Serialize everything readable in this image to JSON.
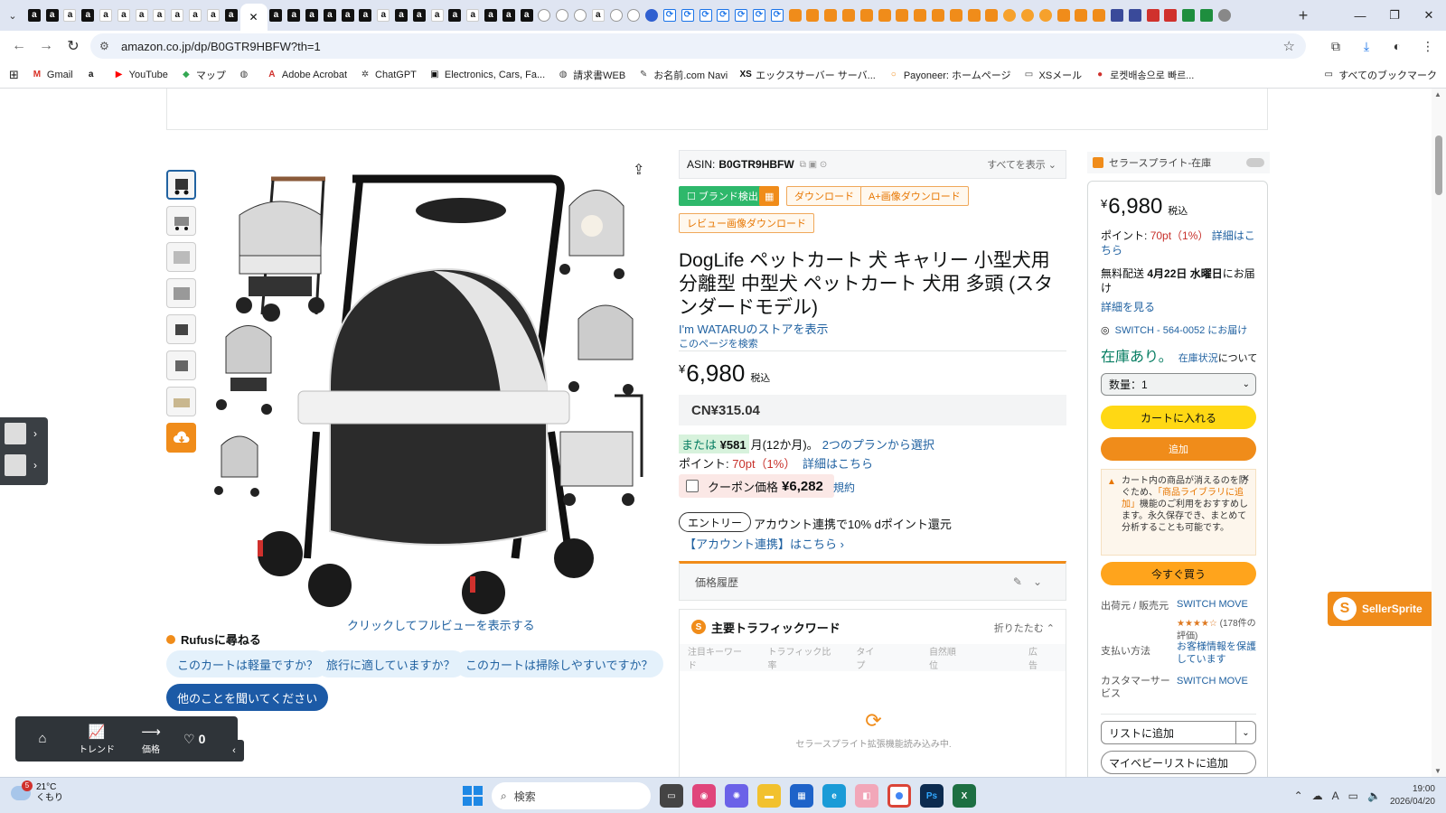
{
  "browser": {
    "url": "amazon.co.jp/dp/B0GTR9HBFW?th=1",
    "tab_icon_kinds": [
      "amz-black",
      "amz-black",
      "amz-white",
      "amz-black",
      "amz-white",
      "amz-white",
      "amz-white",
      "amz-white",
      "amz-white",
      "amz-white",
      "amz-white",
      "amz-black",
      "active",
      "amz-black",
      "amz-black",
      "amz-black",
      "amz-black",
      "amz-black",
      "amz-black",
      "amz-white",
      "amz-black",
      "amz-black",
      "amz-white",
      "amz-black",
      "amz-white",
      "amz-black",
      "amz-black",
      "amz-black",
      "circle",
      "circle",
      "circle",
      "amz-white",
      "circle",
      "circle",
      "blue",
      "chat",
      "chat",
      "chat",
      "chat",
      "chat",
      "chat",
      "chat",
      "orange",
      "orange",
      "orange",
      "orange",
      "orange",
      "orange",
      "orange",
      "orange",
      "orange",
      "orange",
      "orange",
      "orange",
      "oc",
      "oc",
      "oc",
      "orange",
      "orange",
      "orange",
      "navy",
      "navy",
      "red",
      "red",
      "green",
      "green",
      "gray"
    ],
    "bookmarks": [
      {
        "label": "Gmail",
        "icon": "gmail-icon",
        "color": "#d93025",
        "glyph": "M"
      },
      {
        "label": "",
        "icon": "amazon-icon",
        "color": "#111111",
        "glyph": "a"
      },
      {
        "label": "YouTube",
        "icon": "youtube-icon",
        "color": "#ff0000",
        "glyph": "▶"
      },
      {
        "label": "マップ",
        "icon": "maps-icon",
        "color": "#34a853",
        "glyph": "◆"
      },
      {
        "label": "",
        "icon": "globe-icon",
        "color": "#444444",
        "glyph": "◍"
      },
      {
        "label": "Adobe Acrobat",
        "icon": "acrobat-icon",
        "color": "#d0312d",
        "glyph": "A"
      },
      {
        "label": "ChatGPT",
        "icon": "chatgpt-icon",
        "color": "#444444",
        "glyph": "✲"
      },
      {
        "label": "Electronics, Cars, Fa...",
        "icon": "shop-icon",
        "color": "#111111",
        "glyph": "▣"
      },
      {
        "label": "請求書WEB",
        "icon": "globe-icon",
        "color": "#444444",
        "glyph": "◍"
      },
      {
        "label": "お名前.com Navi",
        "icon": "onamae-icon",
        "color": "#444444",
        "glyph": "✎"
      },
      {
        "label": "エックスサーバー サーバ...",
        "icon": "xserver-icon",
        "color": "#111111",
        "glyph": "XS"
      },
      {
        "label": "Payoneer: ホームページ",
        "icon": "payoneer-icon",
        "color": "#f08c1a",
        "glyph": "○"
      },
      {
        "label": "XSメール",
        "icon": "folder-icon",
        "color": "#444444",
        "glyph": "▭"
      },
      {
        "label": "로켓배송으로 빠르...",
        "icon": "coupang-icon",
        "color": "#d0312d",
        "glyph": "●"
      }
    ],
    "all_bookmarks": "すべてのブックマーク"
  },
  "gallery": {
    "fullview_link": "クリックしてフルビューを表示する"
  },
  "rufus": {
    "title": "Rufusに尋ねる",
    "chips": [
      "このカートは軽量ですか？",
      "旅行に適していますか？",
      "このカートは掃除しやすいですか？"
    ],
    "ask_more": "他のことを聞いてください"
  },
  "product": {
    "asin_label": "ASIN:",
    "asin": "B0GTR9HBFW",
    "show_all": "すべてを表示",
    "tools": {
      "brand": "ブランド検出",
      "download": "ダウンロード",
      "aplus": "A+画像ダウンロード",
      "review_img": "レビュー画像ダウンロード"
    },
    "title": "DogLife ペットカート 犬 キャリー 小型犬用 分離型 中型犬 ペットカート 犬用 多頭 (スタンダードモデル)",
    "store_link": "I'm WATARUのストアを表示",
    "search_page": "このページを検索",
    "price_symbol": "¥",
    "price": "6,980",
    "tax": "税込",
    "price_cny": "CN¥315.04",
    "installment_prefix": "または",
    "installment_amount": "¥581",
    "installment_suffix": "月(12か月)。",
    "installment_link": "2つのプランから選択",
    "points_label": "ポイント:",
    "points_value": "70pt（1%）",
    "points_link": "詳細はこちら",
    "coupon_label": "クーポン価格",
    "coupon_price": "¥6,282",
    "coupon_terms": "規約",
    "entry_pill": "エントリー",
    "entry_text": "アカウント連携で10% dポイント還元",
    "entry_link": "【アカウント連携】はこちら ›",
    "price_history": "価格履歴",
    "traffic_title": "主要トラフィックワード",
    "traffic_fold": "折りたたむ",
    "traffic_columns": [
      "注目キーワード",
      "トラフィック比率",
      "タイプ",
      "自然順位",
      "広告"
    ],
    "traffic_loading": "セラースプライト拡張機能読み込み中."
  },
  "buybox": {
    "ss_label": "セラースプライト-在庫",
    "price_symbol": "¥",
    "price": "6,980",
    "tax": "税込",
    "points_label": "ポイント:",
    "points_value": "70pt（1%）",
    "points_link": "詳細はこちら",
    "ship_prefix": "無料配送",
    "ship_date": "4月22日 水曜日",
    "ship_suffix": "にお届け",
    "ship_detail": "詳細を見る",
    "address": "SWITCH - 564-0052 にお届け",
    "in_stock": "在庫あり。",
    "stock_link": "在庫状況",
    "stock_suffix": "について",
    "quantity": "数量：1",
    "add_to_cart": "カートに入れる",
    "add": "追加",
    "notice_p1": "カート内の商品が消えるのを防ぐため、",
    "notice_link": "「商品ライブラリに追加」",
    "notice_p2": "機能のご利用をおすすめします。永久保存でき、まとめて分析することも可能です。",
    "buy_now": "今すぐ買う",
    "ships_from_label": "出荷元 / 販売元",
    "ships_from": "SWITCH MOVE",
    "rating_count": "(178件の評価)",
    "rating_stars": 4,
    "payment_label": "支払い方法",
    "payment_value": "お客様情報を保護しています",
    "support_label": "カスタマーサービス",
    "support_value": "SWITCH MOVE",
    "add_to_list": "リストに追加",
    "my_list": "マイベビーリストに追加"
  },
  "extension": {
    "seller_sprite": "SellerSprite",
    "float_trend": "トレンド",
    "float_price": "価格",
    "float_likes": "0"
  },
  "taskbar": {
    "temp": "21°C",
    "weather": "くもり",
    "weather_badge": "5",
    "search": "検索",
    "time": "19:00",
    "date": "2026/04/20"
  },
  "colors": {
    "amazon_link": "#2162a1",
    "buy_yellow": "#ffd814",
    "buy_orange": "#ffa41c",
    "sprite_orange": "#f08c1a",
    "stock_green": "#067d62"
  }
}
